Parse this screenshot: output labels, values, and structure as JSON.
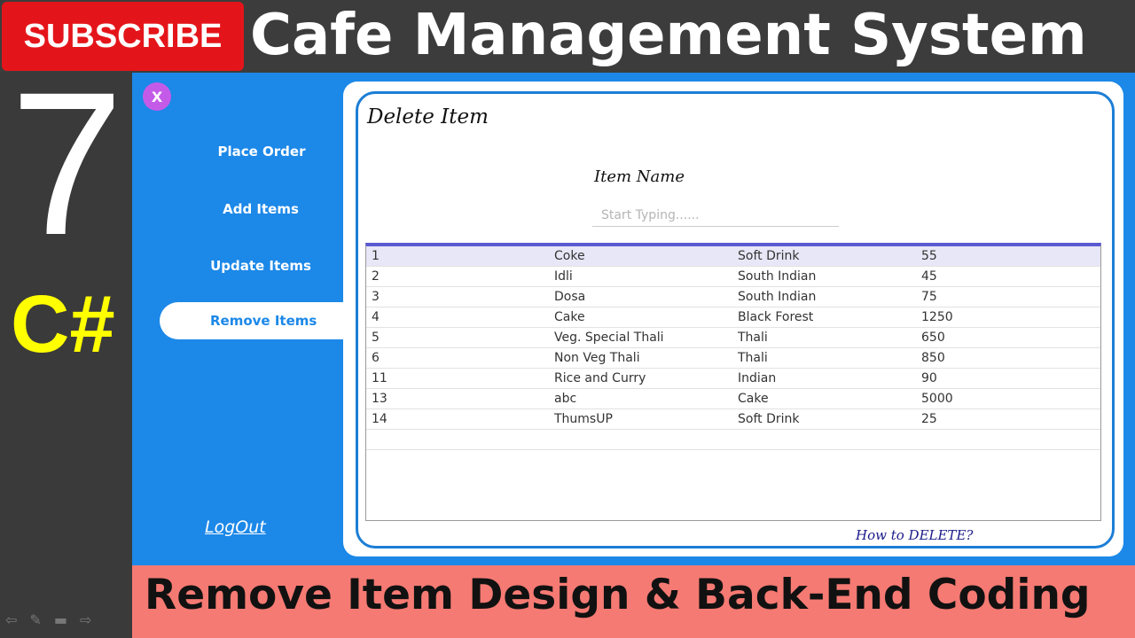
{
  "banner": {
    "subscribe_label": "SUBSCRIBE",
    "title": "Cafe Management System",
    "episode_number": "7",
    "language": "C#",
    "bottom_caption": "Remove Item Design & Back-End Coding"
  },
  "app": {
    "close_label": "X",
    "nav": {
      "place_order": "Place Order",
      "add_items": "Add Items",
      "update_items": "Update Items",
      "remove_items": "Remove Items"
    },
    "logout_label": "LogOut",
    "panel_title": "Delete Item",
    "item_name_label": "Item Name",
    "item_name_placeholder": "Start Typing......",
    "item_name_value": "",
    "help_link": "How to DELETE?",
    "rows": [
      {
        "id": "1",
        "name": "Coke",
        "category": "Soft Drink",
        "price": "55"
      },
      {
        "id": "2",
        "name": "Idli",
        "category": "South Indian",
        "price": "45"
      },
      {
        "id": "3",
        "name": "Dosa",
        "category": "South Indian",
        "price": "75"
      },
      {
        "id": "4",
        "name": "Cake",
        "category": "Black Forest",
        "price": "1250"
      },
      {
        "id": "5",
        "name": "Veg. Special Thali",
        "category": "Thali",
        "price": "650"
      },
      {
        "id": "6",
        "name": "Non Veg Thali",
        "category": "Thali",
        "price": "850"
      },
      {
        "id": "11",
        "name": "Rice and Curry",
        "category": "Indian",
        "price": "90"
      },
      {
        "id": "13",
        "name": "abc",
        "category": "Cake",
        "price": "5000"
      },
      {
        "id": "14",
        "name": "ThumsUP",
        "category": "Soft Drink",
        "price": "25"
      }
    ]
  },
  "colors": {
    "app_blue": "#1c88e8",
    "subscribe_red": "#e4151a",
    "bottom_banner": "#f57a73",
    "csharp_yellow": "#ffff00"
  }
}
